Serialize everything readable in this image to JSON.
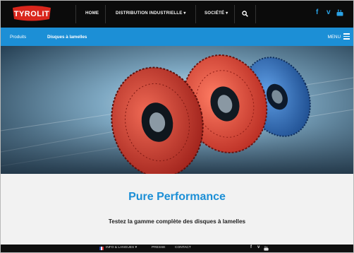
{
  "brand": {
    "logo_text": "TYROLIT"
  },
  "topnav": {
    "items": [
      {
        "label": "HOME"
      },
      {
        "label": "DISTRIBUTION INDUSTRIELLE"
      },
      {
        "label": "SOCIÉTÉ"
      }
    ],
    "dropdown_glyph": "▾",
    "search_icon": "search-icon",
    "social": [
      "facebook-icon",
      "vimeo-icon",
      "youtube-icon"
    ]
  },
  "breadcrumb": {
    "items": [
      {
        "label": "Produits"
      },
      {
        "label": "Disques à lamelles"
      }
    ],
    "menu_label": "MENU"
  },
  "hero": {
    "background_color": "#4c8cae",
    "disc_colors": [
      "#c92f27",
      "#e14a3b",
      "#2f6fbf"
    ]
  },
  "band": {
    "title": "Pure Performance",
    "subtitle": "Testez la gamme complète des disques à lamelles"
  },
  "footer": {
    "items": [
      "INFO & LANGUES",
      "PRESSE",
      "CONTACT"
    ]
  },
  "colors": {
    "accent": "#1c8fd6",
    "nav_bg": "#0b0b0b"
  }
}
